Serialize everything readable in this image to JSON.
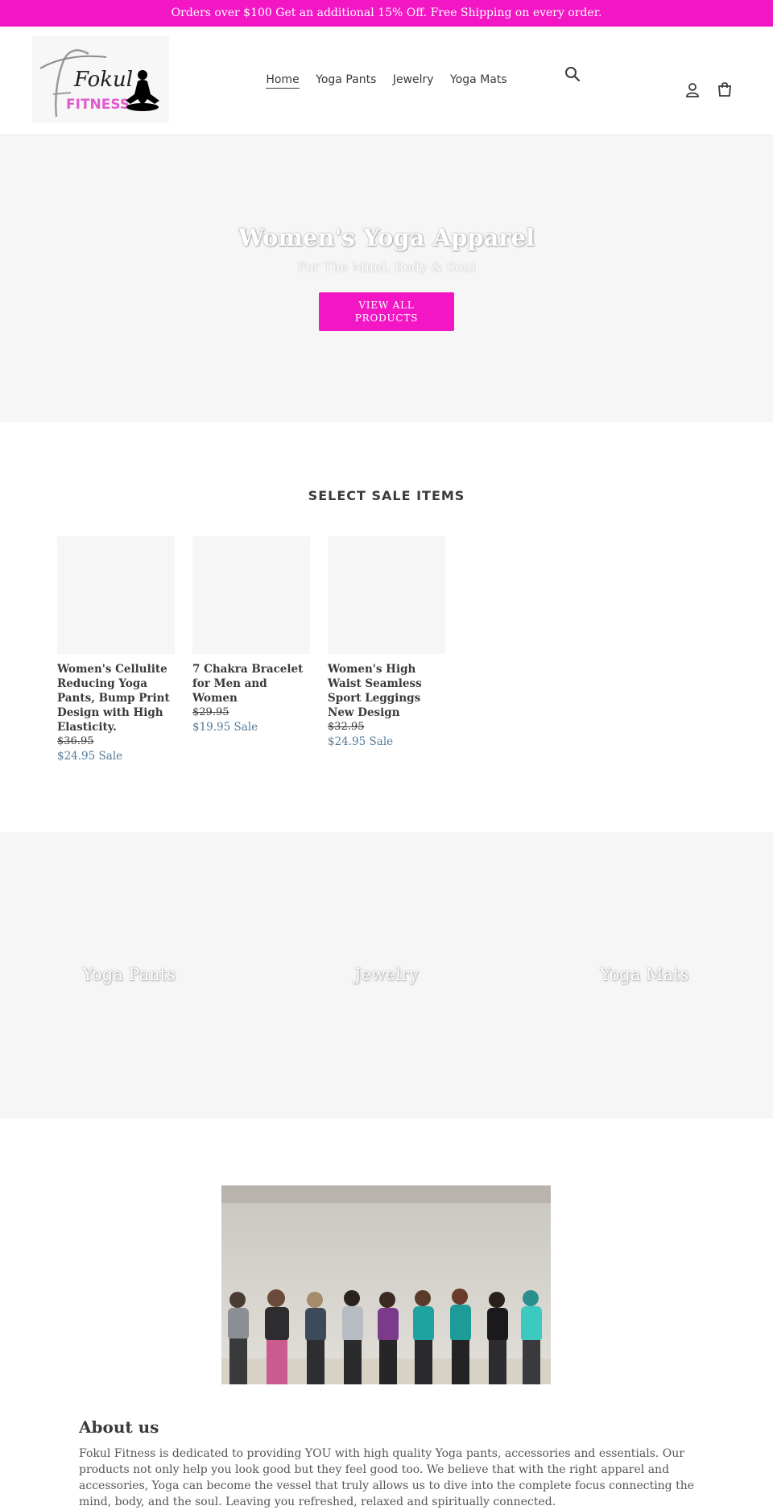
{
  "announcement": "Orders over $100 Get an additional 15% Off. Free Shipping on every order.",
  "brand": {
    "logo_text_1": "Fokul",
    "logo_text_2": "FITNESS",
    "accent": "#f216c4",
    "sale_color": "#557b97"
  },
  "nav": [
    {
      "label": "Home",
      "active": true
    },
    {
      "label": "Yoga Pants"
    },
    {
      "label": "Jewelry"
    },
    {
      "label": "Yoga Mats"
    }
  ],
  "icons": {
    "search": "search-icon",
    "account": "account-icon",
    "cart": "cart-icon"
  },
  "hero": {
    "title": "Women's Yoga Apparel",
    "subtitle": "For The Mind, Body & Soul",
    "button_line1": "VIEW ALL",
    "button_line2": "PRODUCTS"
  },
  "sale": {
    "heading": "SELECT SALE ITEMS",
    "products": [
      {
        "title": "Women's Cellulite Reducing Yoga Pants, Bump Print Design with High Elasticity.",
        "old_price": "$36.95",
        "price": "$24.95",
        "sale_label": "Sale"
      },
      {
        "title": "7 Chakra Bracelet for Men and Women",
        "old_price": "$29.95",
        "price": "$19.95",
        "sale_label": "Sale"
      },
      {
        "title": "Women's High Waist Seamless Sport Leggings New Design",
        "old_price": "$32.95",
        "price": "$24.95",
        "sale_label": "Sale"
      }
    ]
  },
  "collections": [
    "Yoga Pants",
    "Jewelry",
    "Yoga Mats"
  ],
  "about": {
    "title": "About us",
    "text": "Fokul Fitness is dedicated to providing YOU with high quality Yoga pants, accessories and essentials. Our products not only help you look good but they feel good too. We believe that with the right apparel and accessories, Yoga can become the vessel that truly allows us to dive into the complete focus connecting the mind, body, and the soul. Leaving you refreshed, relaxed and spiritually connected."
  }
}
